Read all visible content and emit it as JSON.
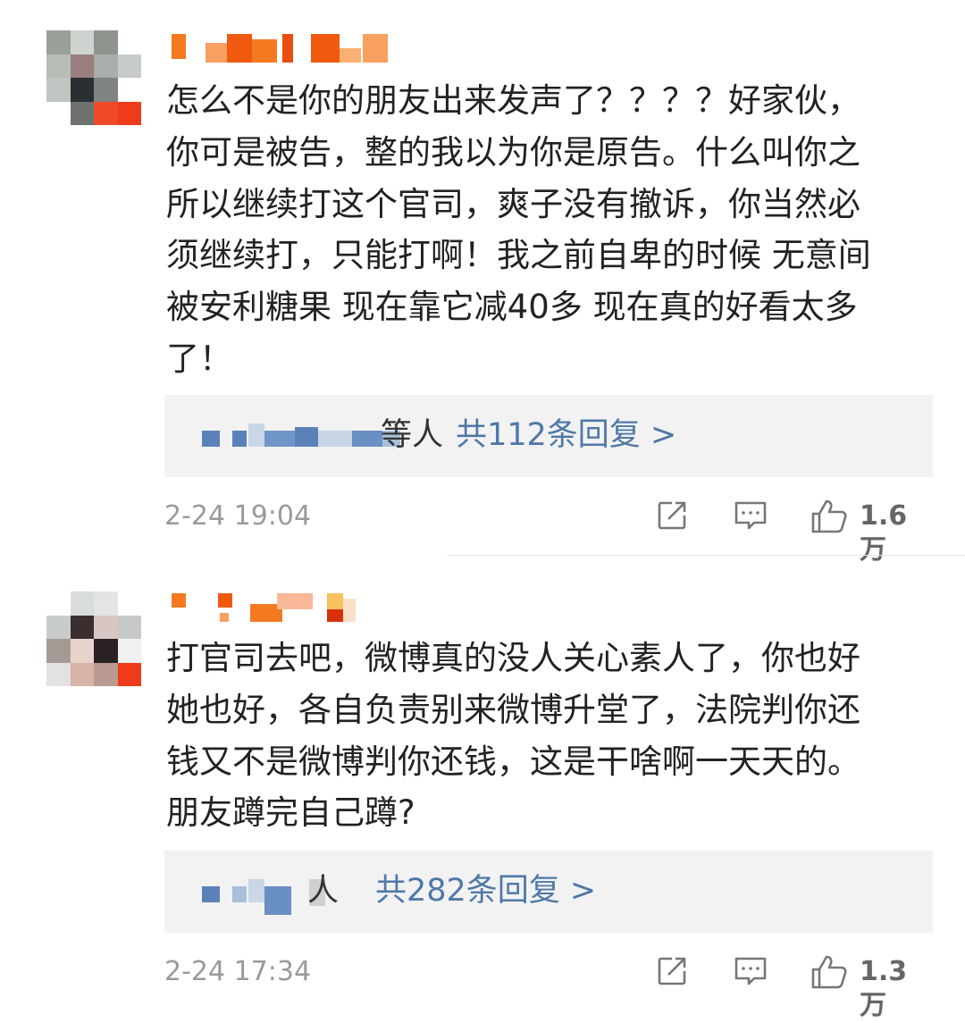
{
  "comments": [
    {
      "text": "怎么不是你的朋友出来发声了？？？？好家伙，\n你可是被告，整的我以为你是原告。什么叫你之\n所以继续打这个官司，爽子没有撤诉，你当然必\n须继续打，只能打啊！我之前自卑的时候 无意间\n被安利糖果 现在靠它减40多 现在真的好看太多\n了！",
      "reply_suffix": "等人",
      "reply_link": "共112条回复 >",
      "timestamp": "2-24 19:04",
      "like_count": "1.6万"
    },
    {
      "text": "打官司去吧，微博真的没人关心素人了，你也好\n她也好，各自负责别来微博升堂了，法院判你还\n钱又不是微博判你还钱，这是干啥啊一天天的。\n朋友蹲完自己蹲?",
      "reply_suffix": "人",
      "reply_link": "共282条回复 >",
      "timestamp": "2-24 17:34",
      "like_count": "1.3万"
    }
  ],
  "icons": {
    "share": "share-icon",
    "reply": "comment-icon",
    "like": "thumbs-up-icon"
  },
  "colors": {
    "link": "#4f78a8",
    "username_redacted": "#f47a20",
    "timestamp": "#9a9a9a",
    "reply_box": "#f2f2f2"
  }
}
